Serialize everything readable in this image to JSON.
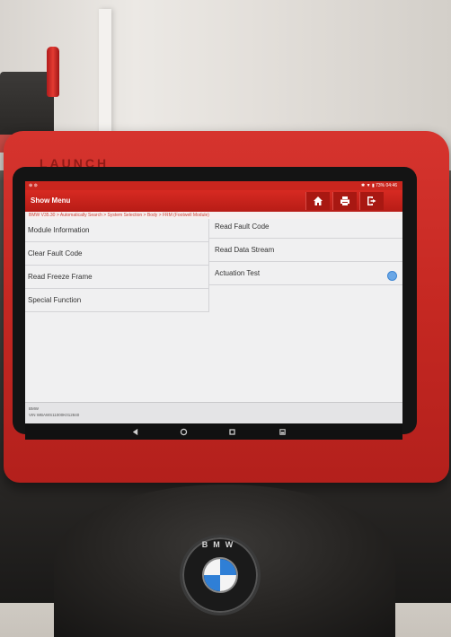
{
  "status_bar": {
    "left": "⊕ ⊚",
    "right": "✱ ▼ ▮ 73% 04:46"
  },
  "header": {
    "title": "Show Menu"
  },
  "breadcrumb": "BMW V35.30 > Automatically Search > System Selection > Body > FRM (Footwell Module)",
  "menu": {
    "left": [
      "Module Information",
      "Clear Fault Code",
      "Read Freeze Frame",
      "Special Function"
    ],
    "right": [
      "Read Fault Code",
      "Read Data Stream",
      "Actuation Test"
    ]
  },
  "footer": {
    "make": "BMW",
    "vin": "VIN WBAWS11000K012840"
  },
  "tablet_brand": "LAUNCH",
  "car_logo": "BMW",
  "colors": {
    "accent_red": "#c9261e",
    "screen_bg": "#f0f0f1",
    "scroll_blue": "#6aa7e6"
  },
  "icons": [
    "home-icon",
    "print-icon",
    "exit-icon",
    "back-nav-icon",
    "home-nav-icon",
    "recent-apps-icon",
    "screenshot-icon",
    "scroll-indicator-icon"
  ]
}
